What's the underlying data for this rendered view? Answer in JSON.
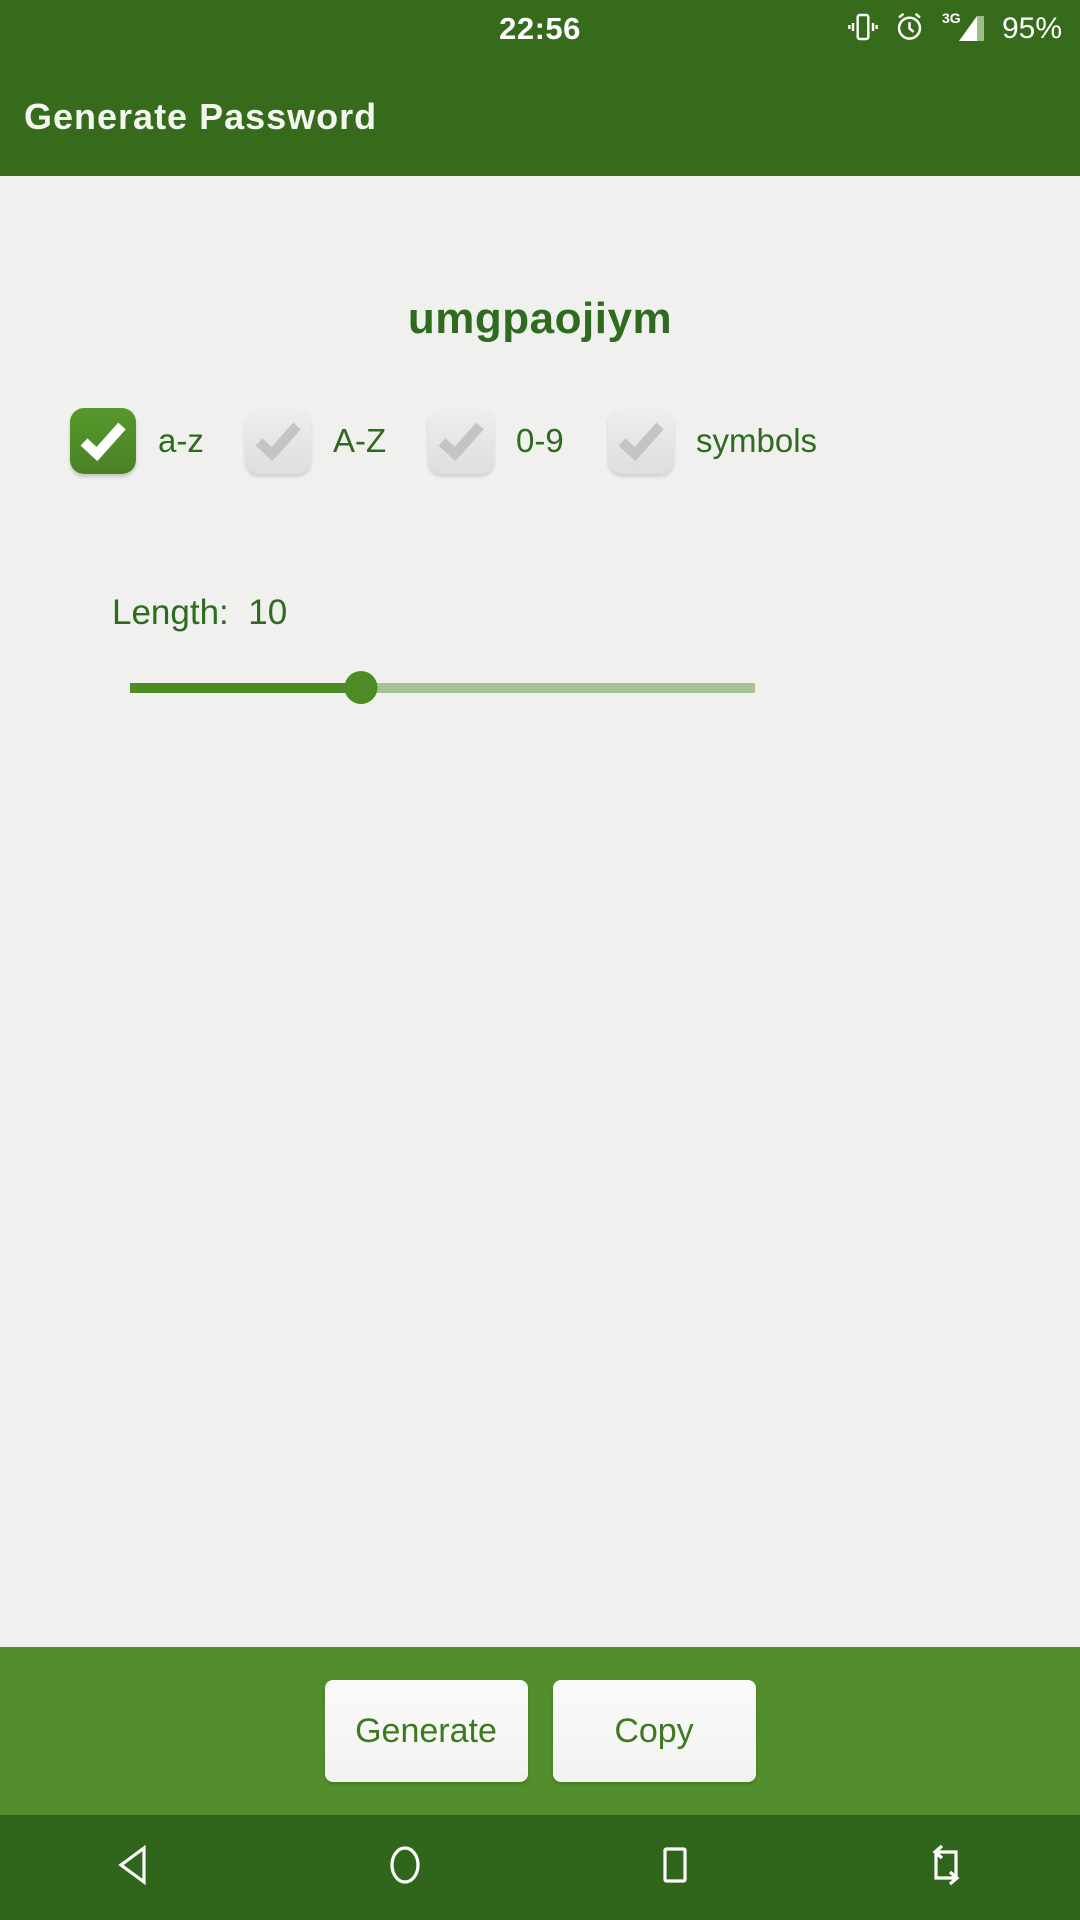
{
  "status_bar": {
    "clock": "22:56",
    "battery": "95%",
    "network": "3G",
    "icons": [
      "vibrate-icon",
      "alarm-icon",
      "signal-icon"
    ]
  },
  "app_bar": {
    "title": "Generate Password"
  },
  "main": {
    "password": "umgpaojiym",
    "charset_options": [
      {
        "label": "a-z",
        "checked": true
      },
      {
        "label": "A-Z",
        "checked": false
      },
      {
        "label": "0-9",
        "checked": false
      },
      {
        "label": "symbols",
        "checked": false
      }
    ],
    "length": {
      "label": "Length:  10",
      "value": 10,
      "min": 1,
      "max": 26,
      "fill_percent": 37
    }
  },
  "action_bar": {
    "generate_label": "Generate",
    "copy_label": "Copy"
  },
  "nav_bar": {
    "items": [
      "back-icon",
      "home-icon",
      "recents-icon",
      "rotate-icon"
    ]
  },
  "colors": {
    "app_bar_green": "#376b1c",
    "action_bar_green": "#528f2c",
    "nav_bar_green": "#30661c",
    "accent_green": "#4d8b27",
    "text_green": "#2f6b1f",
    "background": "#f0f0ef",
    "track_inactive": "#a6c192"
  }
}
